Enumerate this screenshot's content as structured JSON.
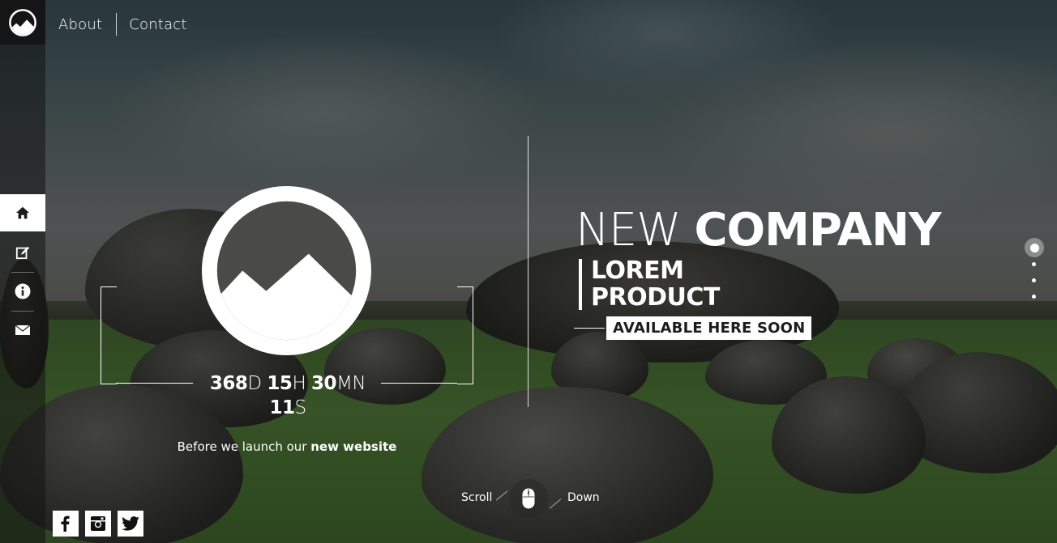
{
  "nav": {
    "about": "About",
    "contact": "Contact"
  },
  "sidebar": {
    "items": [
      {
        "icon": "home-icon",
        "active": true
      },
      {
        "icon": "edit-icon",
        "active": false
      },
      {
        "icon": "info-icon",
        "active": false
      },
      {
        "icon": "mail-icon",
        "active": false
      }
    ]
  },
  "countdown": {
    "days": "368",
    "days_unit": "D",
    "hours": "15",
    "hours_unit": "H",
    "minutes": "30",
    "minutes_unit": "MN",
    "seconds": "11",
    "seconds_unit": "S"
  },
  "launch": {
    "text": "Before we launch our ",
    "emphasis": "new website"
  },
  "headline": {
    "light": "NEW ",
    "bold": "COMPANY",
    "product_line1": "LOREM",
    "product_line2": "PRODUCT",
    "available": "AVAILABLE HERE SOON"
  },
  "scroll": {
    "left": "Scroll",
    "right": "Down"
  },
  "section_dots": {
    "count": 4,
    "active_index": 0
  },
  "social": [
    "facebook-icon",
    "instagram-icon",
    "twitter-icon"
  ],
  "colors": {
    "accent": "#ffffff",
    "sidebar_dark": "#151515",
    "badge_text": "#1d1d1d"
  }
}
